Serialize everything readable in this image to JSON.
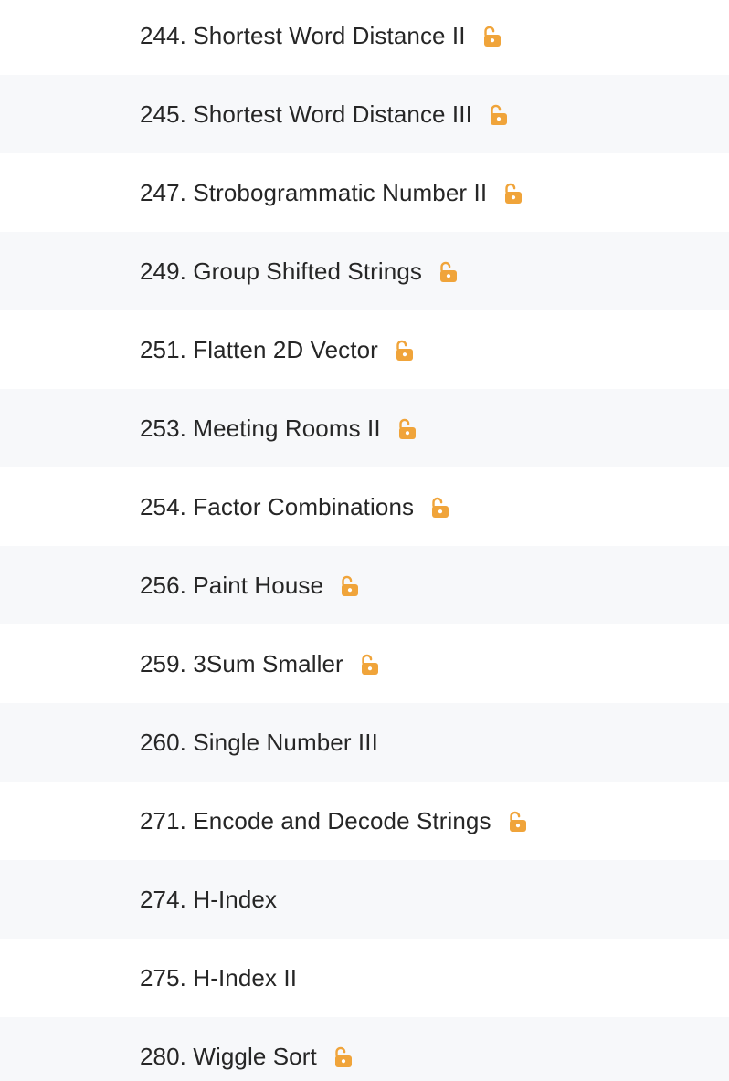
{
  "accent_color": "#f0a43a",
  "problems": [
    {
      "title": "244. Shortest Word Distance II",
      "locked": true
    },
    {
      "title": "245. Shortest Word Distance III",
      "locked": true
    },
    {
      "title": "247. Strobogrammatic Number II",
      "locked": true
    },
    {
      "title": "249. Group Shifted Strings",
      "locked": true
    },
    {
      "title": "251. Flatten 2D Vector",
      "locked": true
    },
    {
      "title": "253. Meeting Rooms II",
      "locked": true
    },
    {
      "title": "254. Factor Combinations",
      "locked": true
    },
    {
      "title": "256. Paint House",
      "locked": true
    },
    {
      "title": "259. 3Sum Smaller",
      "locked": true
    },
    {
      "title": "260. Single Number III",
      "locked": false
    },
    {
      "title": "271. Encode and Decode Strings",
      "locked": true
    },
    {
      "title": "274. H-Index",
      "locked": false
    },
    {
      "title": "275. H-Index II",
      "locked": false
    },
    {
      "title": "280. Wiggle Sort",
      "locked": true
    }
  ]
}
